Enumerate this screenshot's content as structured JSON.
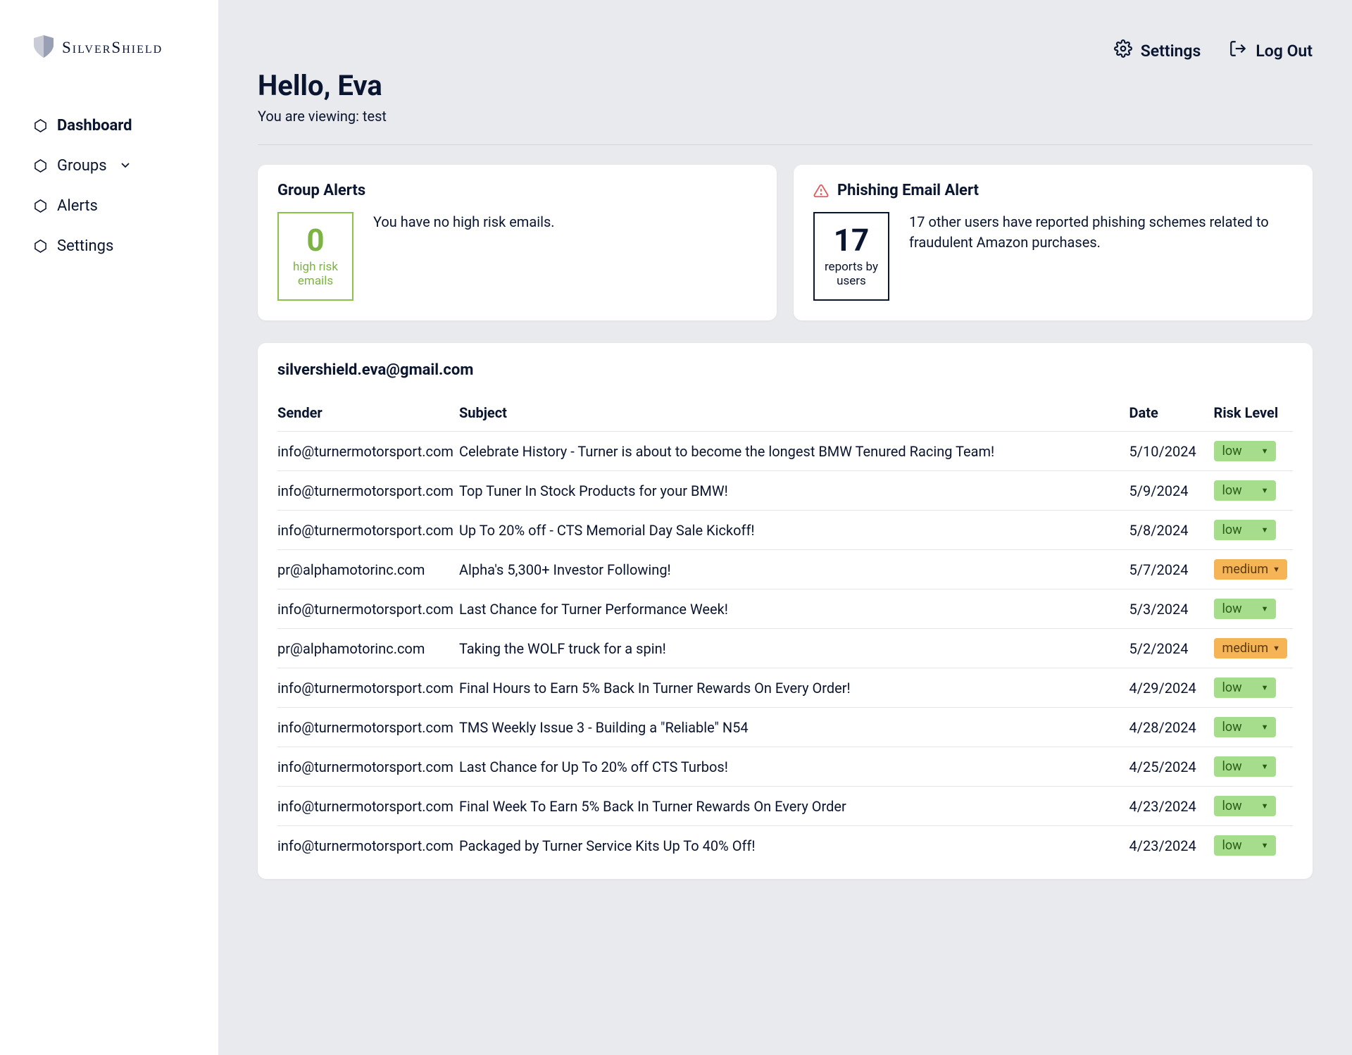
{
  "brand": "SilverShield",
  "nav": {
    "dashboard": "Dashboard",
    "groups": "Groups",
    "alerts": "Alerts",
    "settings": "Settings"
  },
  "topbar": {
    "settings": "Settings",
    "logout": "Log Out"
  },
  "greeting": "Hello, Eva",
  "subgreeting": "You are viewing: test",
  "group_alerts": {
    "title": "Group Alerts",
    "count": "0",
    "count_label": "high risk emails",
    "text": "You have no high risk emails."
  },
  "phishing": {
    "title": "Phishing Email Alert",
    "count": "17",
    "count_label": "reports by users",
    "text": "17 other users have reported phishing schemes related to fraudulent Amazon purchases."
  },
  "inbox": {
    "email": "silvershield.eva@gmail.com",
    "headers": {
      "sender": "Sender",
      "subject": "Subject",
      "date": "Date",
      "risk": "Risk Level"
    },
    "rows": [
      {
        "sender": "info@turnermotorsport.com",
        "subject": "Celebrate History - Turner is about to become the longest BMW Tenured Racing Team!",
        "date": "5/10/2024",
        "risk": "low"
      },
      {
        "sender": "info@turnermotorsport.com",
        "subject": "Top Tuner In Stock Products for your BMW!",
        "date": "5/9/2024",
        "risk": "low"
      },
      {
        "sender": "info@turnermotorsport.com",
        "subject": "Up To 20% off - CTS Memorial Day Sale Kickoff!",
        "date": "5/8/2024",
        "risk": "low"
      },
      {
        "sender": "pr@alphamotorinc.com",
        "subject": "Alpha's 5,300+ Investor Following!",
        "date": "5/7/2024",
        "risk": "medium"
      },
      {
        "sender": "info@turnermotorsport.com",
        "subject": "Last Chance for Turner Performance Week!",
        "date": "5/3/2024",
        "risk": "low"
      },
      {
        "sender": "pr@alphamotorinc.com",
        "subject": "Taking the WOLF truck for a spin!",
        "date": "5/2/2024",
        "risk": "medium"
      },
      {
        "sender": "info@turnermotorsport.com",
        "subject": "Final Hours to Earn 5% Back In Turner Rewards On Every Order!",
        "date": "4/29/2024",
        "risk": "low"
      },
      {
        "sender": "info@turnermotorsport.com",
        "subject": "TMS Weekly Issue 3 - Building a \"Reliable\" N54",
        "date": "4/28/2024",
        "risk": "low"
      },
      {
        "sender": "info@turnermotorsport.com",
        "subject": "Last Chance for Up To 20% off CTS Turbos!",
        "date": "4/25/2024",
        "risk": "low"
      },
      {
        "sender": "info@turnermotorsport.com",
        "subject": "Final Week To Earn 5% Back In Turner Rewards On Every Order",
        "date": "4/23/2024",
        "risk": "low"
      },
      {
        "sender": "info@turnermotorsport.com",
        "subject": "Packaged by Turner Service Kits Up To 40% Off!",
        "date": "4/23/2024",
        "risk": "low"
      }
    ]
  }
}
